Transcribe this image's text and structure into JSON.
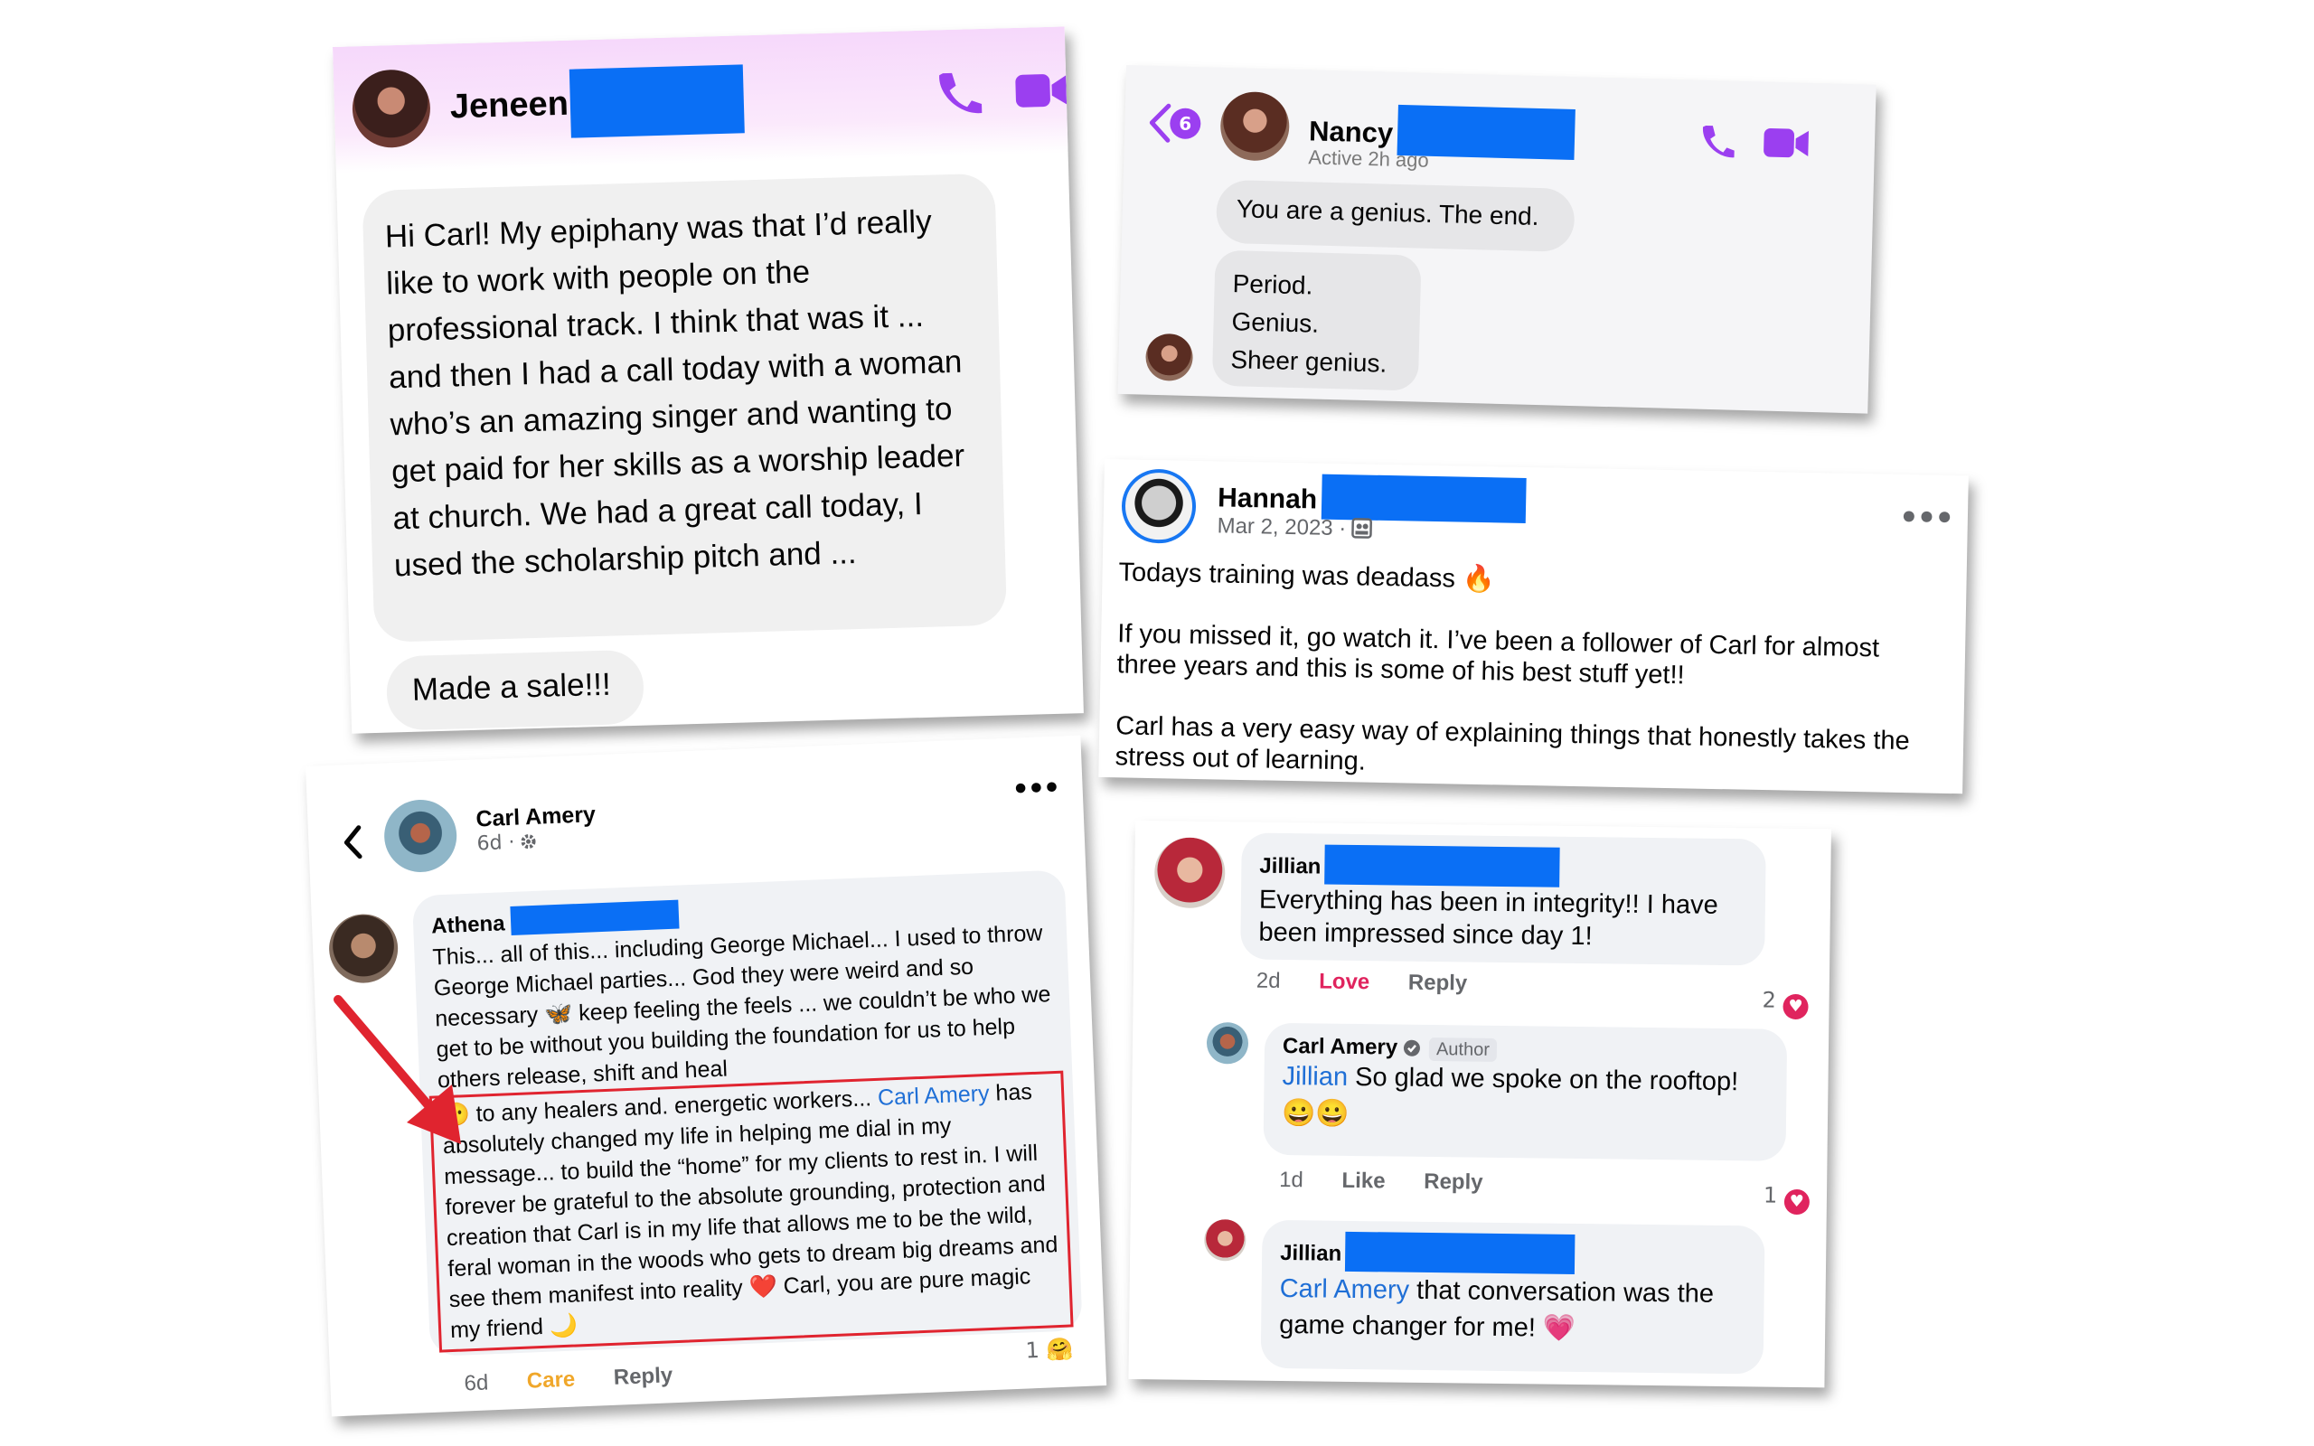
{
  "jeneen": {
    "name": "Jeneen",
    "message": "Hi Carl! My epiphany was that I’d really like to work with people on the professional track. I think that was it ... and then I had a call today with a woman who’s an amazing singer and wanting to get paid for her skills as a worship leader at church. We had a great call today, I used the scholarship pitch and ...",
    "followup": "Made a sale!!!"
  },
  "nancy": {
    "badge_count": "6",
    "name": "Nancy",
    "status": "Active 2h ago",
    "message1": "You are a genius. The end.",
    "message2_lines": [
      "Period.",
      "Genius.",
      "Sheer genius."
    ]
  },
  "hannah": {
    "name": "Hannah",
    "date": "Mar 2, 2023 ·",
    "para1": "Todays training was deadass 🔥",
    "para2": "If you missed it, go watch it. I’ve been a follower of Carl for almost three years and this is some of his best stuff yet!!",
    "para3": "Carl has a very easy way of explaining things that honestly takes the stress out of learning."
  },
  "carl_post": {
    "author": "Carl Amery",
    "time": "6d ·",
    "comment_author": "Athena",
    "comment_before_box": "This... all of this... including George Michael... I used to throw George Michael parties... God they were weird and so necessary 🦋 keep feeling the feels ... we couldn’t be who we get to be without you building the foundation for us to help others release, shift and heal",
    "comment_box_lead": "😶 to any healers and. energetic workers...",
    "comment_box_mention": "Carl Amery",
    "comment_box_rest": "has absolutely changed my life in helping me dial in my message... to build the “home” for my clients to rest in. I will forever be grateful to the absolute grounding, protection and creation that Carl is in my life that allows me to be the wild, feral woman in the woods who gets to dream big dreams and see them manifest into reality ❤️ Carl, you are pure magic my friend 🌙",
    "reaction_count": "1",
    "reaction_emoji": "🤗",
    "time_ago": "6d",
    "care": "Care",
    "reply": "Reply"
  },
  "jillian": {
    "name": "Jillian",
    "comment": "Everything has been in integrity!! I have been impressed since day 1!",
    "time": "2d",
    "love": "Love",
    "reply": "Reply",
    "count": "2",
    "reply_author": "Carl Amery",
    "author_badge": "Author",
    "reply_mention": "Jillian",
    "reply_text": "So glad we spoke on the rooftop!",
    "reply_emojis": "😀😀",
    "reply_time": "1d",
    "like": "Like",
    "reply2": "Reply",
    "reply_count": "1",
    "name2": "Jillian",
    "comment2_mention": "Carl Amery",
    "comment2_text": "that conversation was the game changer for me! 💗"
  },
  "colors": {
    "purple": "#9b3ff0",
    "redaction": "#0a6ff5",
    "mention_blue": "#1f6fd6",
    "love_red": "#e0245e",
    "care_orange": "#f0a72a",
    "highlight_red": "#e0242f"
  }
}
